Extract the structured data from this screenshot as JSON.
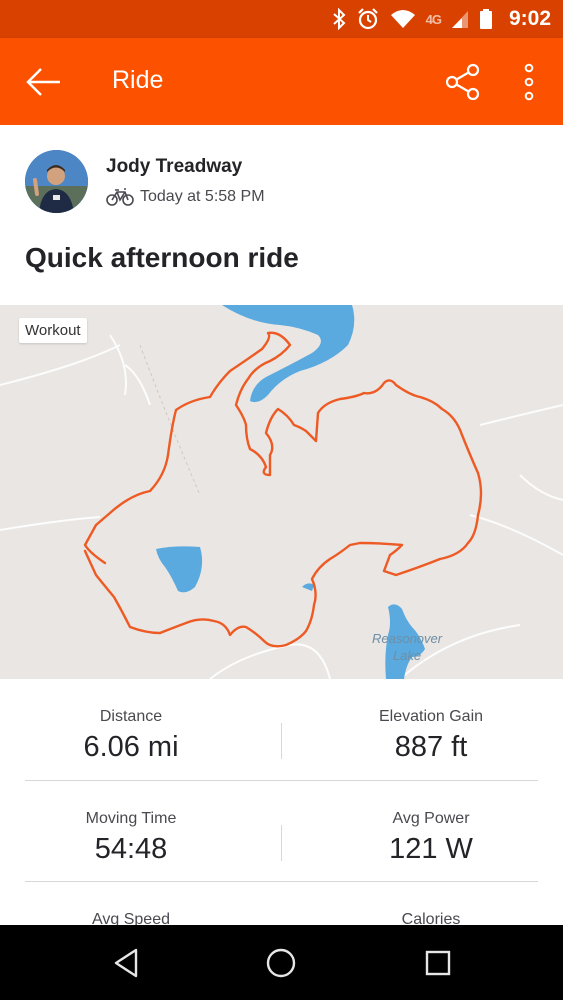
{
  "status_bar": {
    "time": "9:02",
    "network": "4G",
    "icons": [
      "bluetooth-icon",
      "alarm-icon",
      "wifi-icon",
      "signal-icon",
      "battery-icon"
    ]
  },
  "app_bar": {
    "title": "Ride",
    "icons": [
      "back-arrow-icon",
      "share-icon",
      "more-vert-icon"
    ],
    "color": "#fc5200"
  },
  "activity": {
    "athlete_name": "Jody Treadway",
    "time": "Today at 5:58 PM",
    "title": "Quick afternoon ride",
    "type_icon": "bicycle-icon"
  },
  "map": {
    "badge": "Workout",
    "lake_label_line1": "Reasonover",
    "lake_label_line2": "Lake",
    "route_color": "#ee5a24"
  },
  "stats": {
    "distance_label": "Distance",
    "distance_value": "6.06 mi",
    "elevation_label": "Elevation Gain",
    "elevation_value": "887 ft",
    "moving_time_label": "Moving Time",
    "moving_time_value": "54:48",
    "power_label": "Avg Power",
    "power_value": "121 W",
    "speed_label": "Avg Speed",
    "calories_label": "Calories"
  },
  "nav_bar": {
    "icons": [
      "nav-back-icon",
      "nav-home-icon",
      "nav-recents-icon"
    ]
  }
}
